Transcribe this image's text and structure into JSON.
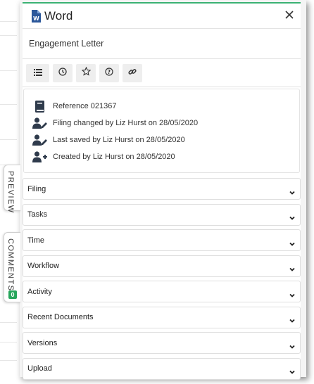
{
  "app": {
    "title": "Word"
  },
  "document": {
    "name": "Engagement Letter"
  },
  "toolbar": {
    "buttons": [
      {
        "icon": "list-icon"
      },
      {
        "icon": "clock-icon"
      },
      {
        "icon": "star-icon"
      },
      {
        "icon": "help-icon"
      },
      {
        "icon": "link-icon"
      }
    ]
  },
  "info": {
    "reference": "Reference 021367",
    "filing_changed": "Filing changed by Liz Hurst on 28/05/2020",
    "last_saved": "Last saved by Liz Hurst on 28/05/2020",
    "created": "Created by Liz Hurst on 28/05/2020"
  },
  "side_tabs": {
    "preview": "PREVIEW",
    "comments": "COMMENTS",
    "comments_count": "0"
  },
  "sections": [
    {
      "label": "Filing"
    },
    {
      "label": "Tasks"
    },
    {
      "label": "Time"
    },
    {
      "label": "Workflow"
    },
    {
      "label": "Activity"
    },
    {
      "label": "Recent Documents"
    },
    {
      "label": "Versions"
    },
    {
      "label": "Upload"
    }
  ],
  "colors": {
    "accent": "#3bb273",
    "word_blue": "#2b579a",
    "badge_green": "#26a65b",
    "icon_dark": "#2f3b4c"
  }
}
